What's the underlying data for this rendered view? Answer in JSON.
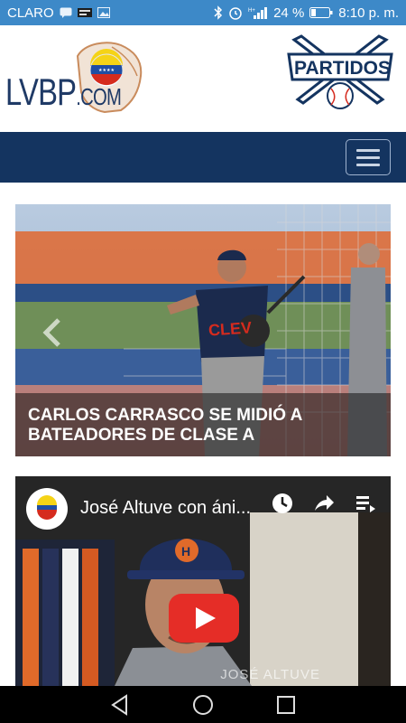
{
  "status_bar": {
    "carrier": "CLARO",
    "battery": "24 %",
    "time": "8:10 p. m."
  },
  "header": {
    "logo_text": "LVBP",
    "logo_domain": ".COM",
    "partidos_label": "PARTIDOS"
  },
  "carousel": {
    "caption": "CARLOS CARRASCO SE MIDIÓ A BATEADORES DE CLASE A",
    "jersey_text": "CLEV"
  },
  "video": {
    "title": "José Altuve con áni...",
    "watermark": "JOSÉ ALTUVE"
  },
  "colors": {
    "status_bar": "#3d89c8",
    "navbar": "#143460",
    "play": "#e52d27"
  }
}
